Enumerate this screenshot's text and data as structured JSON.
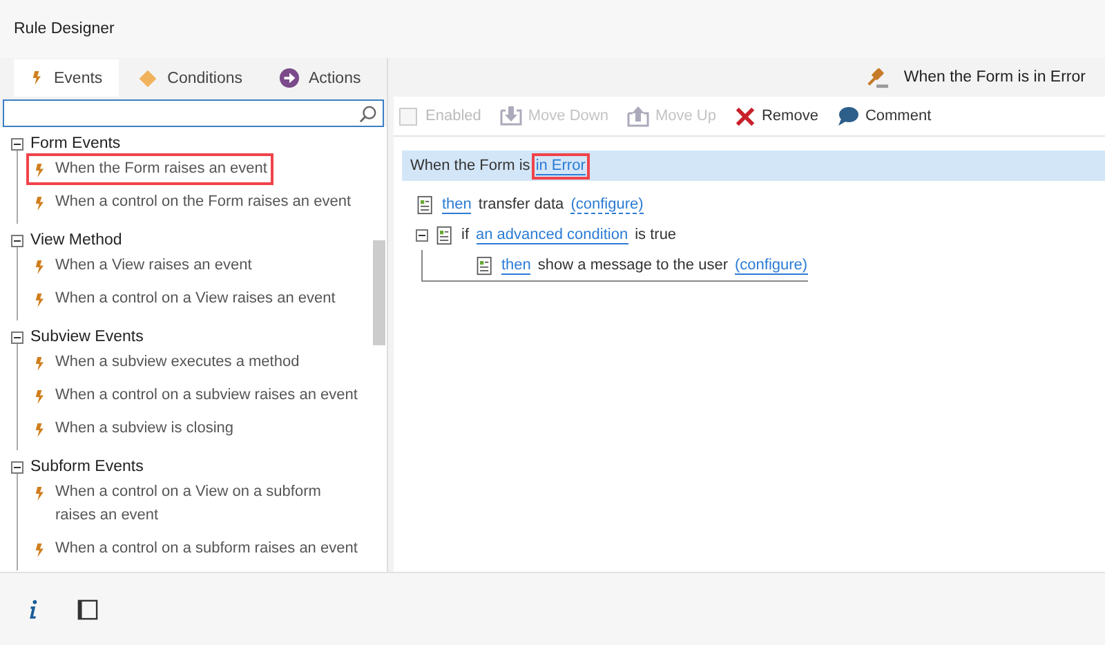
{
  "window": {
    "title": "Rule Designer"
  },
  "tabs": [
    {
      "label": "Events",
      "kind": "events",
      "selected": true
    },
    {
      "label": "Conditions",
      "kind": "conditions",
      "selected": false
    },
    {
      "label": "Actions",
      "kind": "actions",
      "selected": false
    }
  ],
  "tree": [
    {
      "label": "Form Events",
      "expanded": true,
      "children": [
        {
          "label": "When the Form raises an event",
          "selected": true
        },
        {
          "label": "When a control on the Form raises an event",
          "selected": false
        }
      ]
    },
    {
      "label": "View Method",
      "expanded": true,
      "children": [
        {
          "label": "When a View raises an event",
          "selected": false
        },
        {
          "label": "When a control on a View raises an event",
          "selected": false
        }
      ]
    },
    {
      "label": "Subview Events",
      "expanded": true,
      "children": [
        {
          "label": "When a subview executes a method",
          "selected": false
        },
        {
          "label": "When a control on a subview raises an event",
          "selected": false
        },
        {
          "label": "When a subview is closing",
          "selected": false
        }
      ]
    },
    {
      "label": "Subform Events",
      "expanded": true,
      "children": [
        {
          "label": "When a control on a View on a subform raises an event",
          "selected": false
        },
        {
          "label": "When a control on a subform raises an event",
          "selected": false
        }
      ]
    }
  ],
  "rule_title": "When the Form is in Error",
  "toolbar": [
    {
      "label": "Enabled",
      "kind": "checkbox",
      "checked": false,
      "disabled": true
    },
    {
      "label": "Move Down",
      "kind": "move-down",
      "disabled": true
    },
    {
      "label": "Move Up",
      "kind": "move-up",
      "disabled": true
    },
    {
      "label": "Remove",
      "kind": "remove",
      "disabled": false
    },
    {
      "label": "Comment",
      "kind": "comment",
      "disabled": false
    }
  ],
  "rule": {
    "parts": [
      {
        "kind": "text",
        "text": "When the Form is"
      },
      {
        "kind": "link",
        "text": "in Error",
        "highlighted": true
      }
    ],
    "steps": [
      {
        "parts": [
          {
            "kind": "link",
            "text": "then"
          },
          {
            "kind": "text",
            "text": "transfer data"
          },
          {
            "kind": "dashed-link",
            "text": "(configure)"
          }
        ]
      },
      {
        "expanded": true,
        "parts": [
          {
            "kind": "text",
            "text": "if"
          },
          {
            "kind": "link",
            "text": "an advanced condition"
          },
          {
            "kind": "text",
            "text": "is true"
          }
        ],
        "children": [
          {
            "parts": [
              {
                "kind": "link",
                "text": "then"
              },
              {
                "kind": "text",
                "text": "show a message to the user"
              },
              {
                "kind": "link",
                "text": "(configure)"
              }
            ]
          }
        ]
      }
    ]
  }
}
